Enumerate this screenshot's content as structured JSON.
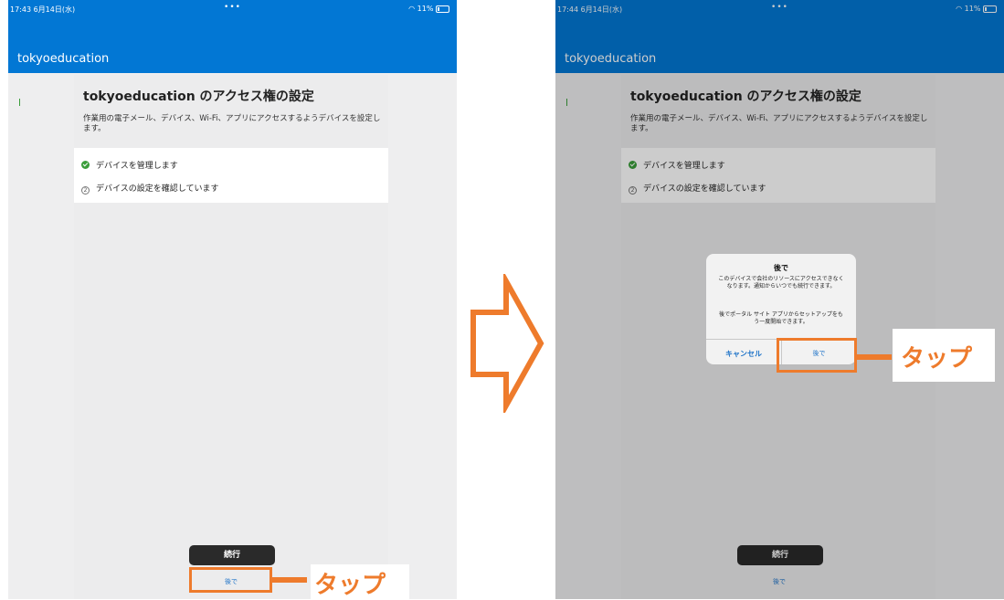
{
  "left": {
    "status": {
      "time": "17:43  6月14日(水)",
      "dots": "•••",
      "battery": "11%"
    },
    "app_title": "tokyoeducation",
    "title": "tokyoeducation のアクセス権の設定",
    "description": "作業用の電子メール、デバイス、Wi-Fi、アプリにアクセスするようデバイスを設定します。",
    "steps": [
      {
        "label": "デバイスを管理します",
        "state": "done"
      },
      {
        "label": "デバイスの設定を確認しています",
        "number": "2"
      }
    ],
    "continue_label": "続行",
    "later_label": "後で",
    "tap": "タップ"
  },
  "right": {
    "status": {
      "time": "17:44  6月14日(水)",
      "dots": "•••",
      "battery": "11%"
    },
    "app_title": "tokyoeducation",
    "title": "tokyoeducation のアクセス権の設定",
    "description": "作業用の電子メール、デバイス、Wi-Fi、アプリにアクセスするようデバイスを設定します。",
    "steps": [
      {
        "label": "デバイスを管理します",
        "state": "done"
      },
      {
        "label": "デバイスの設定を確認しています",
        "number": "2"
      }
    ],
    "continue_label": "続行",
    "later_label": "後で",
    "dialog": {
      "title": "後で",
      "message1": "このデバイスで会社のリソースにアクセスできなくなります。通知からいつでも続行できます。",
      "message2": "後でポータル サイト アプリからセットアップをもう一度開始できます。",
      "cancel": "キャンセル",
      "later": "後で"
    },
    "tap": "タップ"
  },
  "colors": {
    "appbar": "#0277d4",
    "highlight": "#ee7b2c",
    "check": "#3a9d3a",
    "link": "#1e73c8"
  },
  "icons": {
    "arrow": "right-arrow-outline-icon",
    "check": "check-circle-icon",
    "wifi": "wifi-icon",
    "battery": "battery-icon"
  }
}
